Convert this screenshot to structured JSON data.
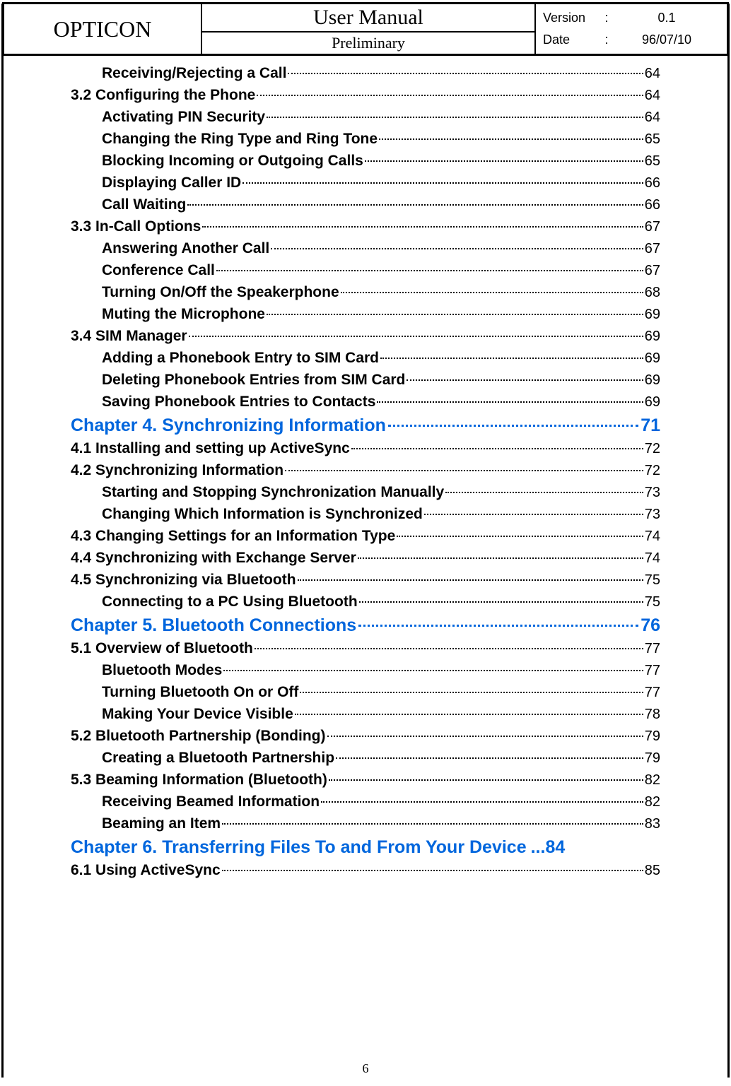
{
  "header": {
    "brand": "OPTICON",
    "title": "User Manual",
    "subtitle": "Preliminary",
    "version_label": "Version",
    "version_value": "0.1",
    "date_label": "Date",
    "date_value": "96/07/10"
  },
  "toc": [
    {
      "type": "sub",
      "title": "Receiving/Rejecting a Call",
      "page": "64"
    },
    {
      "type": "section",
      "title": "3.2 Configuring the Phone",
      "page": "64"
    },
    {
      "type": "sub",
      "title": "Activating PIN Security",
      "page": "64"
    },
    {
      "type": "sub",
      "title": "Changing the Ring Type and Ring Tone",
      "page": "65"
    },
    {
      "type": "sub",
      "title": "Blocking Incoming or Outgoing Calls",
      "page": "65"
    },
    {
      "type": "sub",
      "title": "Displaying Caller ID",
      "page": "66"
    },
    {
      "type": "sub",
      "title": "Call Waiting",
      "page": "66"
    },
    {
      "type": "section",
      "title": "3.3 In-Call Options",
      "page": "67"
    },
    {
      "type": "sub",
      "title": "Answering Another Call",
      "page": "67"
    },
    {
      "type": "sub",
      "title": "Conference Call",
      "page": "67"
    },
    {
      "type": "sub",
      "title": "Turning On/Off the Speakerphone",
      "page": "68"
    },
    {
      "type": "sub",
      "title": "Muting the Microphone",
      "page": "69"
    },
    {
      "type": "section",
      "title": "3.4 SIM Manager",
      "page": "69"
    },
    {
      "type": "sub",
      "title": "Adding a Phonebook Entry to SIM Card",
      "page": "69"
    },
    {
      "type": "sub",
      "title": "Deleting Phonebook Entries from SIM Card",
      "page": "69"
    },
    {
      "type": "sub",
      "title": "Saving Phonebook Entries to Contacts",
      "page": "69"
    },
    {
      "type": "chapter",
      "title": "Chapter 4. Synchronizing Information",
      "page": "71"
    },
    {
      "type": "section",
      "title": "4.1 Installing and setting up ActiveSync",
      "page": "72"
    },
    {
      "type": "section",
      "title": "4.2 Synchronizing Information",
      "page": "72"
    },
    {
      "type": "sub",
      "title": "Starting and Stopping Synchronization Manually",
      "page": "73"
    },
    {
      "type": "sub",
      "title": "Changing Which Information is Synchronized",
      "page": "73"
    },
    {
      "type": "section",
      "title": "4.3 Changing Settings for an Information Type",
      "page": "74"
    },
    {
      "type": "section",
      "title": "4.4 Synchronizing with Exchange Server",
      "page": "74"
    },
    {
      "type": "section",
      "title": "4.5 Synchronizing via Bluetooth",
      "page": "75"
    },
    {
      "type": "sub",
      "title": "Connecting to a PC Using Bluetooth",
      "page": "75"
    },
    {
      "type": "chapter",
      "title": "Chapter 5. Bluetooth Connections",
      "page": "76"
    },
    {
      "type": "section",
      "title": "5.1 Overview of Bluetooth",
      "page": "77"
    },
    {
      "type": "sub",
      "title": "Bluetooth Modes",
      "page": "77"
    },
    {
      "type": "sub",
      "title": "Turning Bluetooth On or Off",
      "page": "77"
    },
    {
      "type": "sub",
      "title": "Making Your Device Visible",
      "page": "78"
    },
    {
      "type": "section",
      "title": "5.2 Bluetooth Partnership (Bonding)",
      "page": "79"
    },
    {
      "type": "sub",
      "title": "Creating a Bluetooth Partnership",
      "page": "79"
    },
    {
      "type": "section",
      "title": "5.3 Beaming Information (Bluetooth)",
      "page": "82"
    },
    {
      "type": "sub",
      "title": "Receiving Beamed Information",
      "page": "82"
    },
    {
      "type": "sub",
      "title": "Beaming an Item",
      "page": "83"
    },
    {
      "type": "chapter_nolead",
      "title": "Chapter 6. Transferring Files To and From Your Device",
      "page": "...84"
    },
    {
      "type": "section",
      "title": "6.1 Using ActiveSync",
      "page": "85"
    }
  ],
  "page_number": "6"
}
